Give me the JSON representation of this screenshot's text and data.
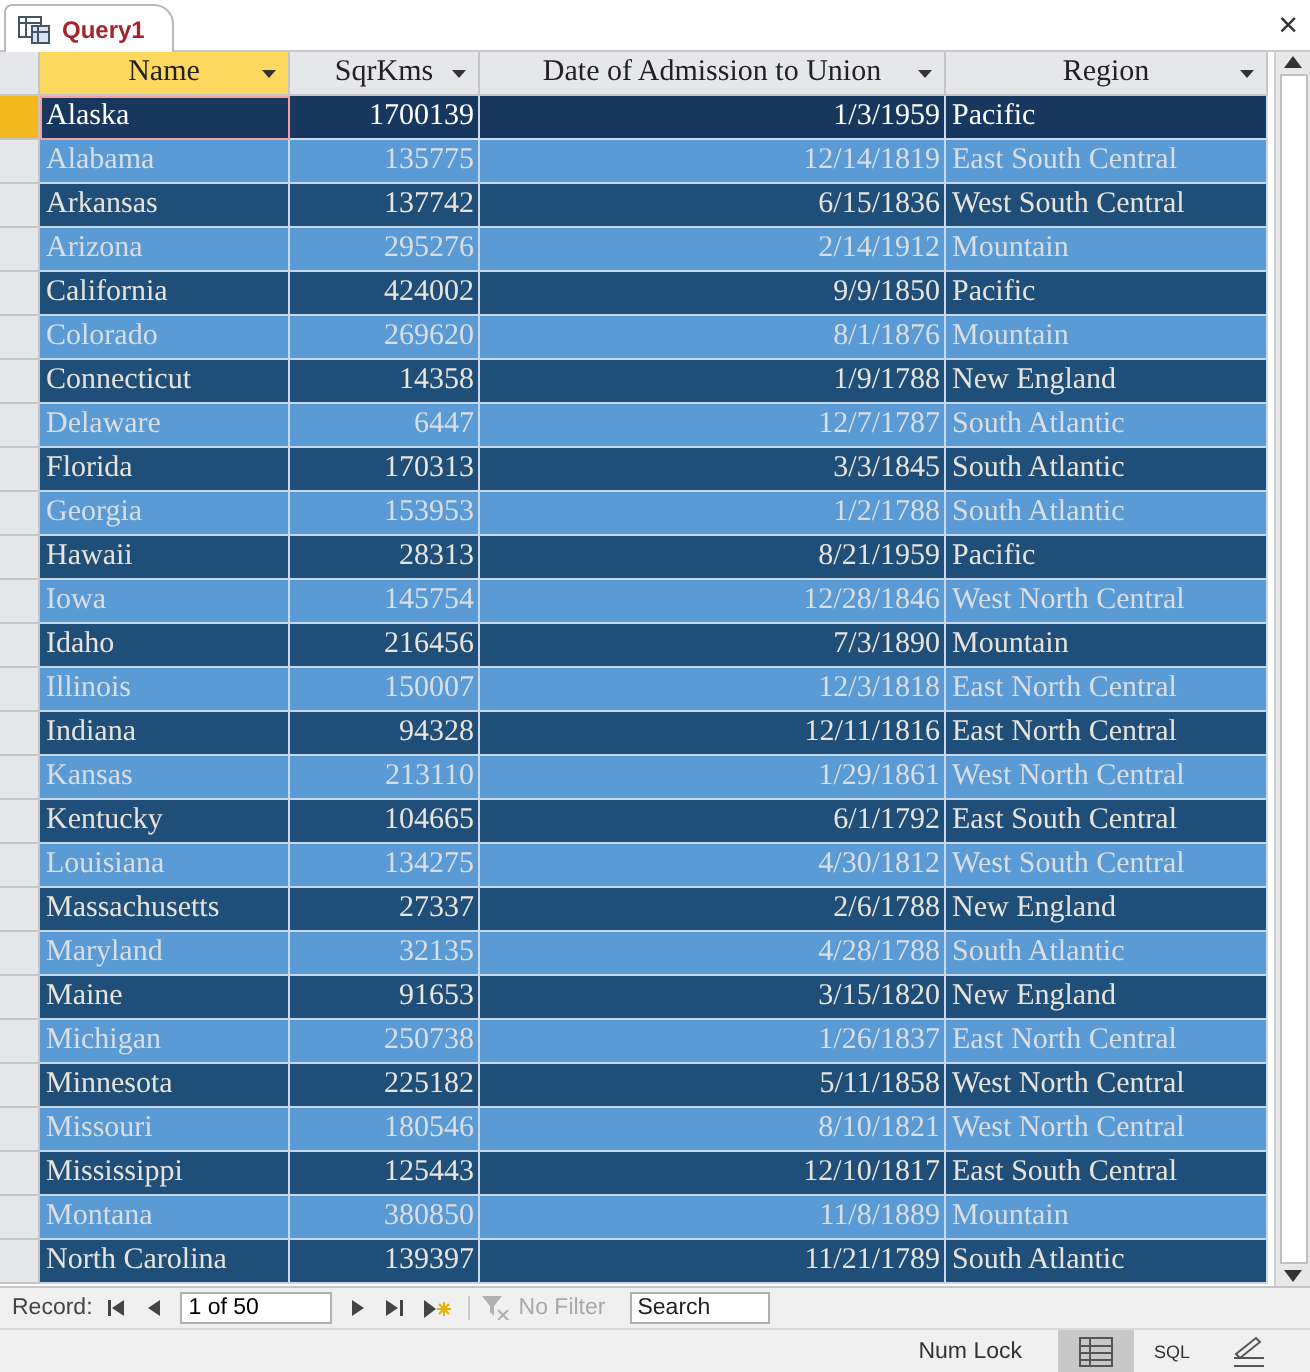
{
  "document_tab": {
    "title": "Query1",
    "close": "×"
  },
  "table": {
    "columns": [
      {
        "label": "Name",
        "active": true,
        "kind": "text"
      },
      {
        "label": "SqrKms",
        "active": false,
        "kind": "number"
      },
      {
        "label": "Date of Admission to Union",
        "active": false,
        "kind": "date"
      },
      {
        "label": "Region",
        "active": false,
        "kind": "text"
      }
    ],
    "rows": [
      {
        "cells": [
          "Alaska",
          "1700139",
          "1/3/1959",
          "Pacific"
        ],
        "selected": true
      },
      {
        "cells": [
          "Alabama",
          "135775",
          "12/14/1819",
          "East South Central"
        ],
        "selected": false
      },
      {
        "cells": [
          "Arkansas",
          "137742",
          "6/15/1836",
          "West South Central"
        ],
        "selected": false
      },
      {
        "cells": [
          "Arizona",
          "295276",
          "2/14/1912",
          "Mountain"
        ],
        "selected": false
      },
      {
        "cells": [
          "California",
          "424002",
          "9/9/1850",
          "Pacific"
        ],
        "selected": false
      },
      {
        "cells": [
          "Colorado",
          "269620",
          "8/1/1876",
          "Mountain"
        ],
        "selected": false
      },
      {
        "cells": [
          "Connecticut",
          "14358",
          "1/9/1788",
          "New England"
        ],
        "selected": false
      },
      {
        "cells": [
          "Delaware",
          "6447",
          "12/7/1787",
          "South Atlantic"
        ],
        "selected": false
      },
      {
        "cells": [
          "Florida",
          "170313",
          "3/3/1845",
          "South Atlantic"
        ],
        "selected": false
      },
      {
        "cells": [
          "Georgia",
          "153953",
          "1/2/1788",
          "South Atlantic"
        ],
        "selected": false
      },
      {
        "cells": [
          "Hawaii",
          "28313",
          "8/21/1959",
          "Pacific"
        ],
        "selected": false
      },
      {
        "cells": [
          "Iowa",
          "145754",
          "12/28/1846",
          "West North Central"
        ],
        "selected": false
      },
      {
        "cells": [
          "Idaho",
          "216456",
          "7/3/1890",
          "Mountain"
        ],
        "selected": false
      },
      {
        "cells": [
          "Illinois",
          "150007",
          "12/3/1818",
          "East North Central"
        ],
        "selected": false
      },
      {
        "cells": [
          "Indiana",
          "94328",
          "12/11/1816",
          "East North Central"
        ],
        "selected": false
      },
      {
        "cells": [
          "Kansas",
          "213110",
          "1/29/1861",
          "West North Central"
        ],
        "selected": false
      },
      {
        "cells": [
          "Kentucky",
          "104665",
          "6/1/1792",
          "East South Central"
        ],
        "selected": false
      },
      {
        "cells": [
          "Louisiana",
          "134275",
          "4/30/1812",
          "West South Central"
        ],
        "selected": false
      },
      {
        "cells": [
          "Massachusetts",
          "27337",
          "2/6/1788",
          "New England"
        ],
        "selected": false
      },
      {
        "cells": [
          "Maryland",
          "32135",
          "4/28/1788",
          "South Atlantic"
        ],
        "selected": false
      },
      {
        "cells": [
          "Maine",
          "91653",
          "3/15/1820",
          "New England"
        ],
        "selected": false
      },
      {
        "cells": [
          "Michigan",
          "250738",
          "1/26/1837",
          "East North Central"
        ],
        "selected": false
      },
      {
        "cells": [
          "Minnesota",
          "225182",
          "5/11/1858",
          "West North Central"
        ],
        "selected": false
      },
      {
        "cells": [
          "Missouri",
          "180546",
          "8/10/1821",
          "West North Central"
        ],
        "selected": false
      },
      {
        "cells": [
          "Mississippi",
          "125443",
          "12/10/1817",
          "East South Central"
        ],
        "selected": false
      },
      {
        "cells": [
          "Montana",
          "380850",
          "11/8/1889",
          "Mountain"
        ],
        "selected": false
      },
      {
        "cells": [
          "North Carolina",
          "139397",
          "11/21/1789",
          "South Atlantic"
        ],
        "selected": false
      }
    ]
  },
  "navigation": {
    "label": "Record:",
    "position": "1 of 50",
    "filter": {
      "label": "No Filter",
      "disabled": true
    },
    "search": {
      "placeholder": "Search"
    }
  },
  "status_bar": {
    "text": "Num Lock",
    "views": [
      {
        "kind": "datasheet",
        "selected": true
      },
      {
        "kind": "sql",
        "label": "SQL",
        "selected": false
      },
      {
        "kind": "design",
        "selected": false
      }
    ]
  }
}
